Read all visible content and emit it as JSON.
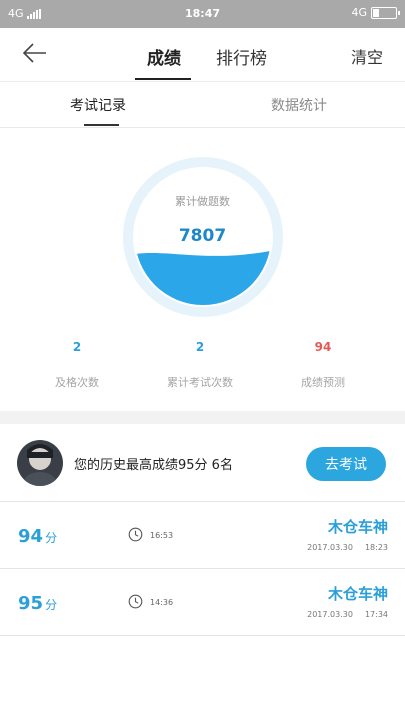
{
  "status_bar": {
    "network_left": "4G",
    "time": "18:47",
    "network_right": "4G"
  },
  "nav": {
    "tabs": [
      {
        "label": "成绩"
      },
      {
        "label": "排行榜"
      }
    ],
    "clear_label": "清空",
    "back_icon": "arrow-left-icon"
  },
  "subtabs": [
    {
      "label": "考试记录"
    },
    {
      "label": "数据统计"
    }
  ],
  "summary": {
    "caption": "累计做题数",
    "total": "7807",
    "water_level": 0.38,
    "colors": {
      "ring": "#e6f3fb",
      "water": "#2ba6e8"
    }
  },
  "stats": [
    {
      "value": "2",
      "label": "及格次数"
    },
    {
      "value": "2",
      "label": "累计考试次数"
    },
    {
      "value": "94",
      "label": "成绩预测"
    }
  ],
  "best": {
    "text": "您的历史最高成绩95分  6名",
    "button": "去考试"
  },
  "records": [
    {
      "score": "94",
      "unit": "分",
      "time": "16:53",
      "name": "木仓车神",
      "date": "2017.03.30",
      "clock": "18:23"
    },
    {
      "score": "95",
      "unit": "分",
      "time": "14:36",
      "name": "木仓车神",
      "date": "2017.03.30",
      "clock": "17:34"
    }
  ],
  "accent_color": "#2ba6de"
}
